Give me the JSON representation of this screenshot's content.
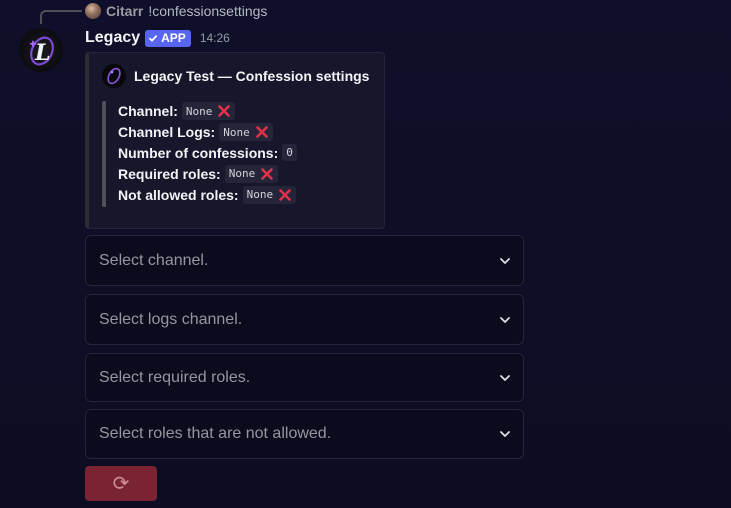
{
  "reply": {
    "author": "Citarr",
    "content": "!confessionsettings"
  },
  "message": {
    "username": "Legacy",
    "badge": "APP",
    "timestamp": "14:26"
  },
  "embed": {
    "author": "Legacy Test — Confession settings",
    "fields": [
      {
        "label": "Channel:",
        "value": "None",
        "status": "cross-mark-icon"
      },
      {
        "label": "Channel Logs:",
        "value": "None",
        "status": "cross-mark-icon"
      },
      {
        "label": "Number of confessions:",
        "value": "0",
        "status": null
      },
      {
        "label": "Required roles:",
        "value": "None",
        "status": "cross-mark-icon"
      },
      {
        "label": "Not allowed roles:",
        "value": "None",
        "status": "cross-mark-icon"
      }
    ]
  },
  "selects": [
    {
      "placeholder": "Select channel."
    },
    {
      "placeholder": "Select logs channel."
    },
    {
      "placeholder": "Select required roles."
    },
    {
      "placeholder": "Select roles that are not allowed."
    }
  ],
  "refresh_button": {
    "icon": "refresh-icon",
    "glyph": "⟳"
  },
  "colors": {
    "accent": "#5865f2",
    "danger_button": "#7a2433",
    "cross_mark": "#e0314b"
  }
}
